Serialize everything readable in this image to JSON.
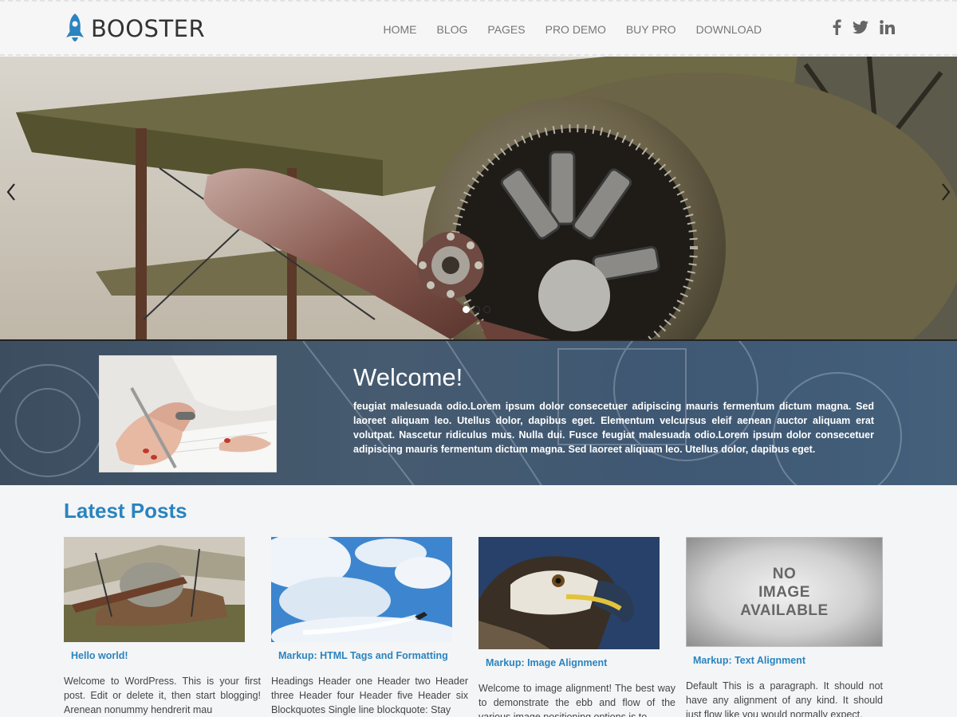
{
  "brand": {
    "name": "BOOSTER",
    "accent": "#2a84c0"
  },
  "nav": {
    "items": [
      "HOME",
      "BLOG",
      "PAGES",
      "PRO DEMO",
      "BUY PRO",
      "DOWNLOAD"
    ]
  },
  "social": [
    "facebook-icon",
    "twitter-icon",
    "linkedin-icon"
  ],
  "slider": {
    "slide_count": 3,
    "active_index": 0
  },
  "welcome": {
    "title": "Welcome!",
    "text": "feugiat malesuada odio.Lorem ipsum dolor consecetuer adipiscing mauris fermentum dictum magna. Sed laoreet aliquam leo. Utellus dolor, dapibus eget. Elementum velcursus eleif aenean auctor aliquam erat volutpat. Nascetur ridiculus mus. Nulla dui. Fusce feugiat malesuada odio.Lorem ipsum dolor consecetuer adipiscing mauris fermentum dictum magna. Sed laoreet aliquam leo. Utellus dolor, dapibus eget."
  },
  "latest": {
    "heading": "Latest Posts",
    "posts": [
      {
        "title": "Hello world!",
        "excerpt": "Welcome to WordPress. This is your first post. Edit or delete it, then start blogging! Arenean nonummy hendrerit mau"
      },
      {
        "title": "Markup: HTML Tags and Formatting",
        "excerpt": "Headings Header one Header two Header three Header four Header five Header six Blockquotes Single line blockquote: Stay"
      },
      {
        "title": "Markup: Image Alignment",
        "excerpt": "Welcome to image alignment! The best way to demonstrate the ebb and flow of the various image positioning options is to"
      },
      {
        "title": "Markup: Text Alignment",
        "excerpt": "Default This is a paragraph. It should not have any alignment of any kind. It should just flow like you would normally expect."
      }
    ],
    "no_image": [
      "NO",
      "IMAGE",
      "AVAILABLE"
    ]
  }
}
